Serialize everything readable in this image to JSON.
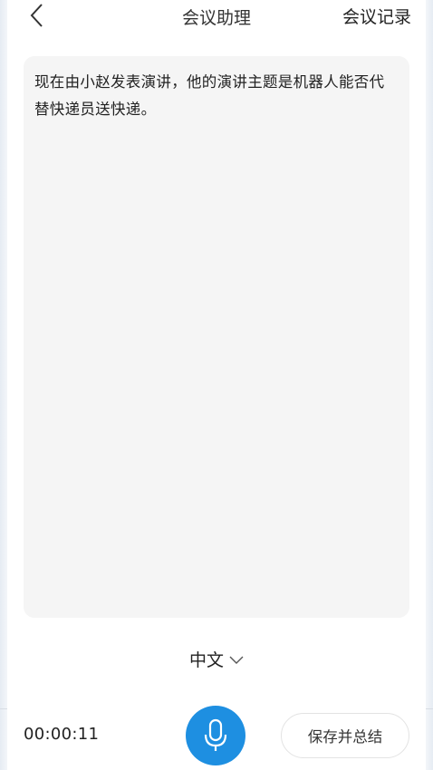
{
  "header": {
    "title": "会议助理",
    "records_label": "会议记录"
  },
  "transcript": {
    "text": "现在由小赵发表演讲，他的演讲主题是机器人能否代替快递员送快递。"
  },
  "language": {
    "selected": "中文"
  },
  "footer": {
    "timer": "00:00:11",
    "save_label": "保存并总结"
  },
  "colors": {
    "accent": "#1e8fe1",
    "panel_bg": "#f5f5f5",
    "text": "#222222"
  },
  "icons": {
    "back": "chevron-left-icon",
    "language_dropdown": "chevron-down-icon",
    "mic": "microphone-icon"
  }
}
